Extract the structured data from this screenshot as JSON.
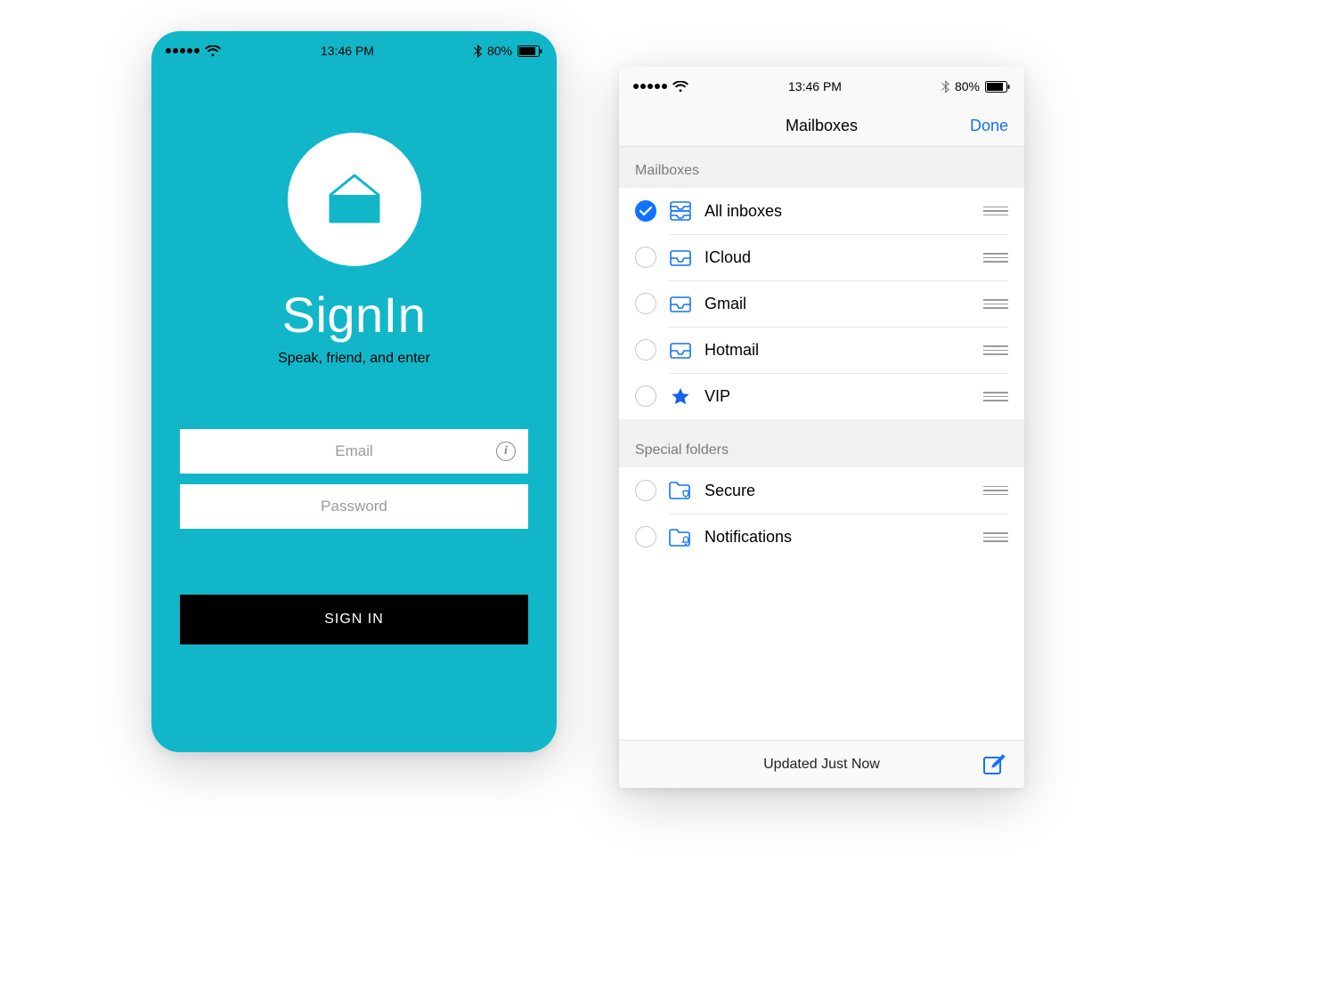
{
  "status": {
    "time": "13:46 PM",
    "battery": "80%"
  },
  "signin": {
    "title": "SignIn",
    "subtitle": "Speak, friend, and enter",
    "email_placeholder": "Email",
    "password_placeholder": "Password",
    "button": "SIGN IN"
  },
  "mail": {
    "nav_title": "Mailboxes",
    "done": "Done",
    "sections": {
      "mailboxes_header": "Mailboxes",
      "special_header": "Special folders"
    },
    "mailboxes": [
      {
        "label": "All inboxes",
        "icon": "inbox-stack",
        "checked": true
      },
      {
        "label": "ICloud",
        "icon": "inbox",
        "checked": false
      },
      {
        "label": "Gmail",
        "icon": "inbox",
        "checked": false
      },
      {
        "label": "Hotmail",
        "icon": "inbox",
        "checked": false
      },
      {
        "label": "VIP",
        "icon": "star",
        "checked": false
      }
    ],
    "special": [
      {
        "label": "Secure",
        "icon": "folder-shield",
        "checked": false
      },
      {
        "label": "Notifications",
        "icon": "folder-bell",
        "checked": false
      }
    ],
    "toolbar_status": "Updated Just Now"
  },
  "colors": {
    "accent_teal": "#11b7c9",
    "ios_blue": "#1072ff"
  }
}
